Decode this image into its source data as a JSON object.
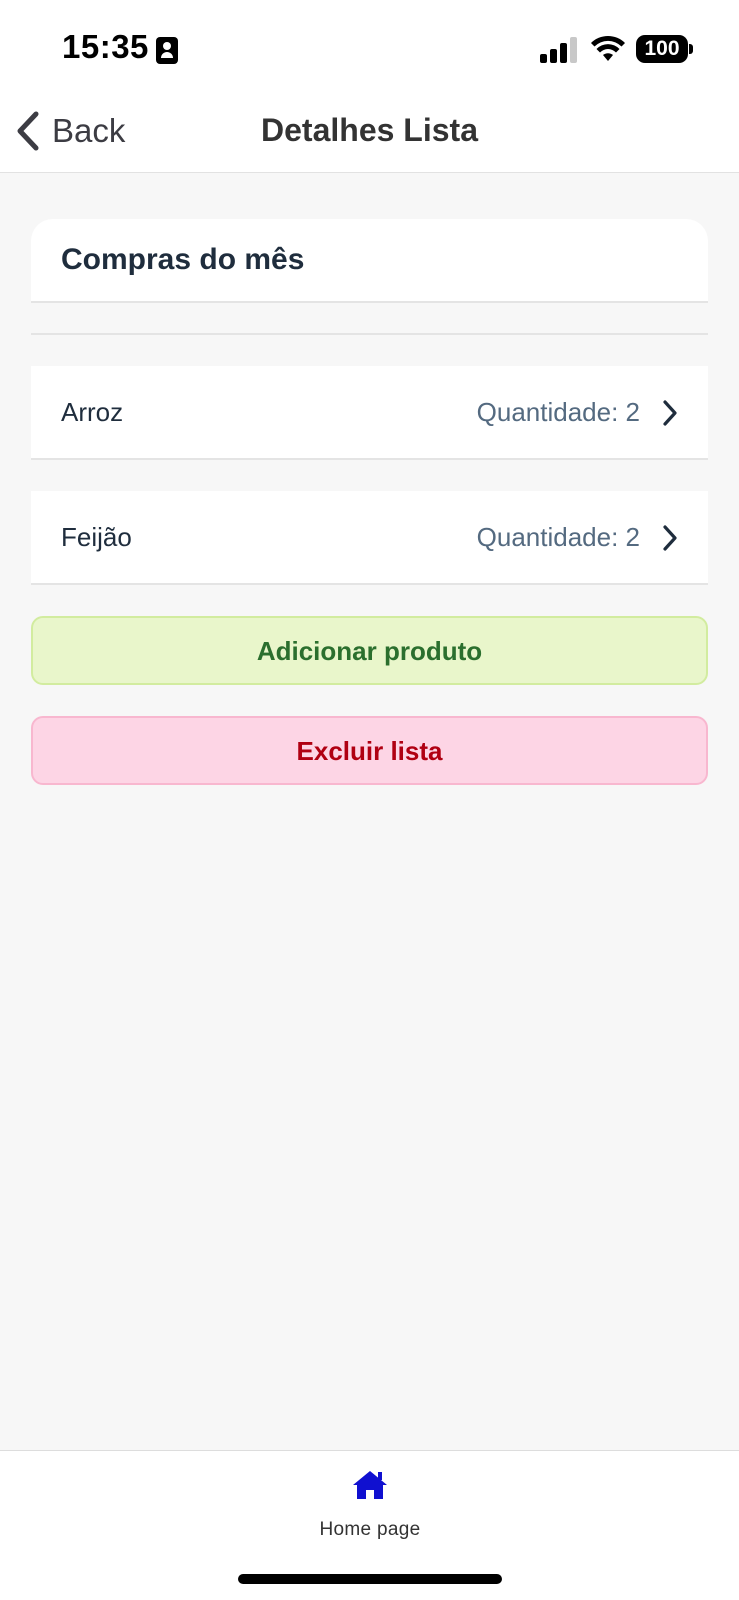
{
  "status_bar": {
    "time": "15:35",
    "battery": "100"
  },
  "nav": {
    "back_label": "Back",
    "title": "Detalhes Lista"
  },
  "list": {
    "name": "Compras do mês",
    "items": [
      {
        "name": "Arroz",
        "quantity_text": "Quantidade: 2"
      },
      {
        "name": "Feijão",
        "quantity_text": "Quantidade: 2"
      }
    ]
  },
  "actions": {
    "add_label": "Adicionar produto",
    "delete_label": "Excluir lista"
  },
  "tab_bar": {
    "home_label": "Home page"
  },
  "colors": {
    "add_bg": "#e9f6cb",
    "add_text": "#2b6f2e",
    "delete_bg": "#fdd5e5",
    "delete_text": "#b00012",
    "tab_active": "#1010d0"
  },
  "icons": {
    "back": "chevron-left-icon",
    "row": "chevron-right-icon",
    "home": "home-icon"
  }
}
